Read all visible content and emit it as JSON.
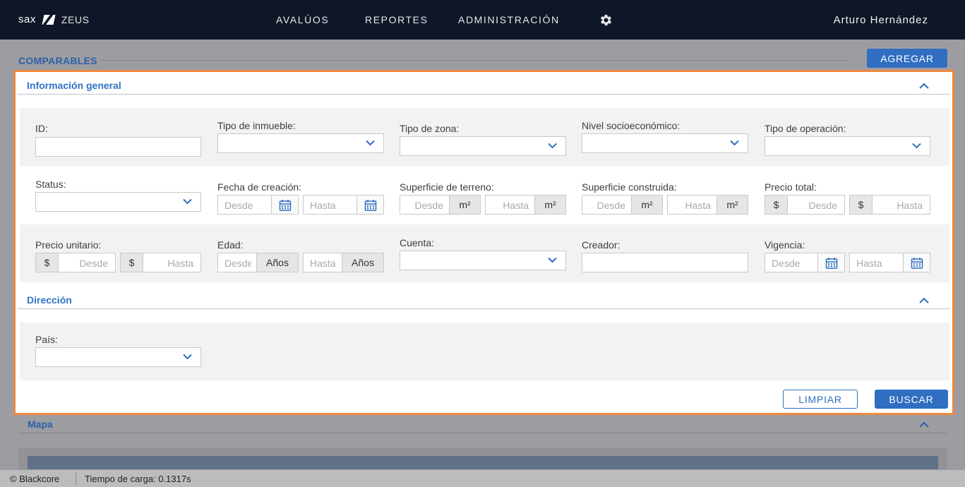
{
  "topbar": {
    "logo_text": "sax",
    "app_name": "ZEUS",
    "nav": [
      "AVALÚOS",
      "REPORTES",
      "ADMINISTRACIÓN"
    ],
    "settings_icon": "gear-icon",
    "user_name": "Arturo Hernández"
  },
  "page": {
    "title": "COMPARABLES",
    "add_label": "AGREGAR"
  },
  "general": {
    "title": "Información general",
    "labels": {
      "id": "ID:",
      "tipo_inmueble": "Tipo de inmueble:",
      "tipo_zona": "Tipo de zona:",
      "nivel": "Nivel socioeconómico:",
      "tipo_operacion": "Tipo de operación:",
      "status": "Status:",
      "fecha": "Fecha de creación:",
      "sup_terreno": "Superficie de terreno:",
      "sup_construida": "Superficie construida:",
      "precio_total": "Precio total:",
      "precio_unitario": "Precio unitario:",
      "edad": "Edad:",
      "cuenta": "Cuenta:",
      "creador": "Creador:",
      "vigencia": "Vigencia:"
    },
    "placeholders": {
      "desde": "Desde",
      "hasta": "Hasta"
    },
    "units": {
      "m2": "m²",
      "currency": "$",
      "years": "Años"
    }
  },
  "direccion": {
    "title": "Dirección",
    "labels": {
      "pais": "País:"
    }
  },
  "actions": {
    "clear_label": "LIMPIAR",
    "search_label": "BUSCAR"
  },
  "map": {
    "title": "Mapa"
  },
  "footer": {
    "copyright": "© Blackcore",
    "load_time": "Tiempo de carga: 0.1317s"
  }
}
